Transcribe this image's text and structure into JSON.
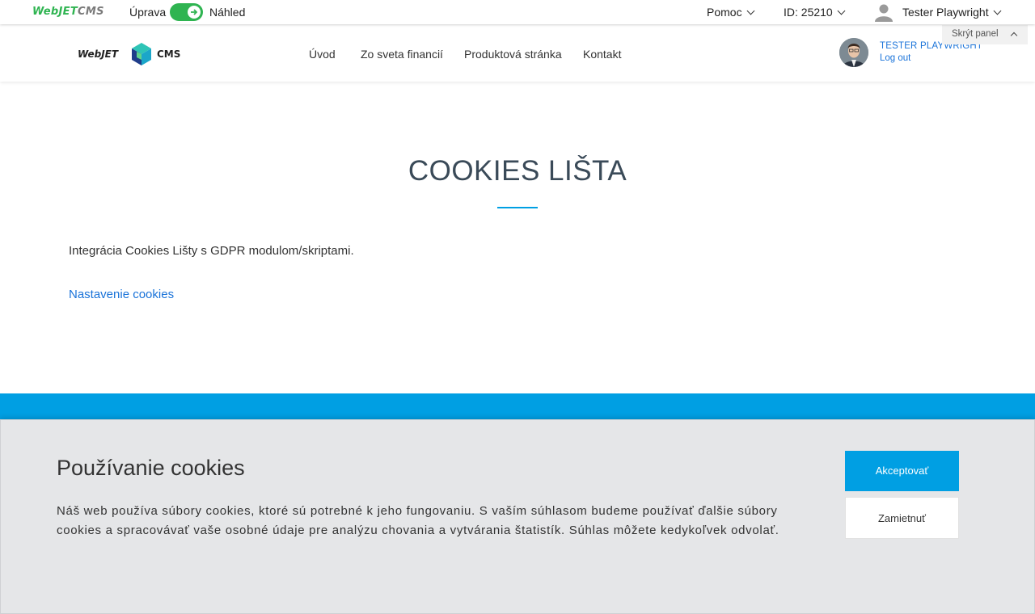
{
  "admin_bar": {
    "logo": {
      "part1": "WebJET",
      "part2": "CMS"
    },
    "mode_edit_label": "Úprava",
    "mode_preview_label": "Náhled",
    "help_label": "Pomoc",
    "page_id_label": "ID: 25210",
    "user_label": "Tester Playwright",
    "hide_panel_label": "Skrýt panel",
    "toggle_color": "#2fb451"
  },
  "site_header": {
    "logo": {
      "part1": "WebJET",
      "part2": "CMS"
    },
    "nav": [
      "Úvod",
      "Zo sveta financií",
      "Produktová stránka",
      "Kontakt"
    ],
    "user_name": "TESTER PLAYWRIGHT",
    "logout_label": "Log out"
  },
  "main": {
    "title": "COOKIES LIŠTA",
    "intro": "Integrácia Cookies Lišty s GDPR modulom/skriptami.",
    "cookie_settings_link": "Nastavenie cookies",
    "accent_color": "#009fe3"
  },
  "cookie_bar": {
    "title": "Používanie cookies",
    "text": "Náš web používa súbory cookies, ktoré sú potrebné k jeho fungovaniu. S vaším súhlasom budeme používať ďalšie súbory cookies a spracovávať vaše osobné údaje pre analýzu chovania a vytvárania štatistík. Súhlas môžete kedykoľvek odvolať.",
    "accept_label": "Akceptovať",
    "reject_label": "Zamietnuť"
  }
}
